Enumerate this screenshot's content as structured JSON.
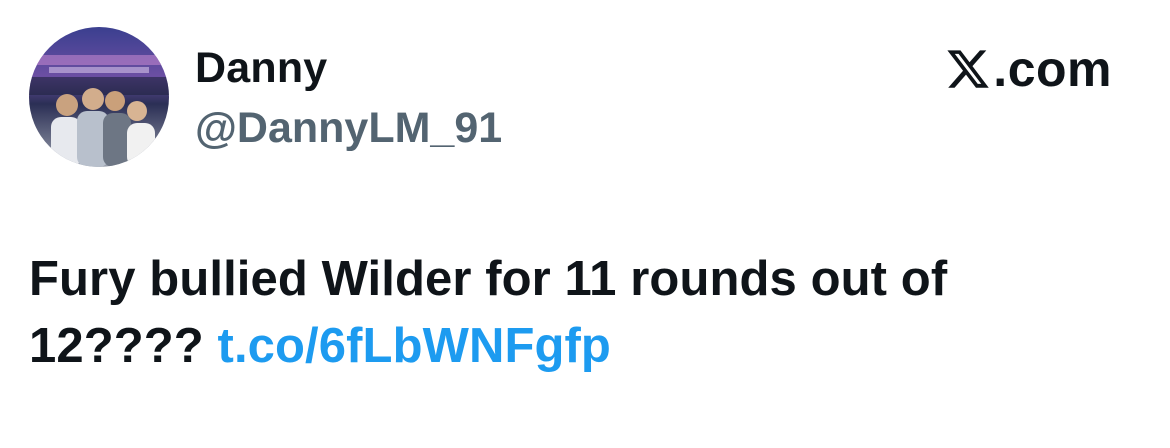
{
  "author": {
    "display_name": "Danny",
    "handle": "@DannyLM_91",
    "avatar_icon": "profile-photo"
  },
  "brand": {
    "icon": "x-logo-icon",
    "text": ".com"
  },
  "tweet": {
    "text_line1": "Fury bullied Wilder for 11 rounds out of",
    "text_line2": "12????",
    "link": "t.co/6fLbWNFgfp"
  },
  "colors": {
    "text": "#0f1419",
    "secondary": "#536471",
    "link": "#1d9bf0"
  }
}
